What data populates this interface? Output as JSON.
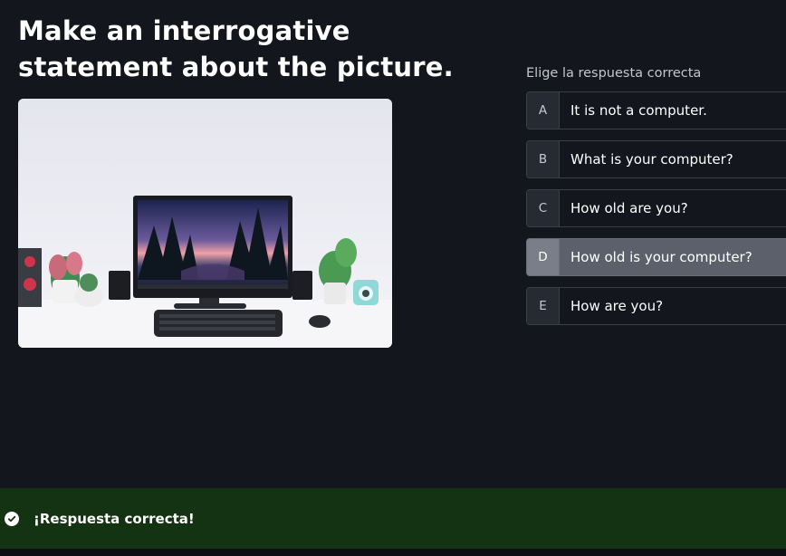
{
  "question": {
    "title": "Make an interrogative statement about the picture."
  },
  "image": {
    "subject": "desk-setup-photo"
  },
  "answers": {
    "prompt": "Elige la respuesta correcta",
    "selected": "D",
    "options": [
      {
        "letter": "A",
        "text": "It is not a computer."
      },
      {
        "letter": "B",
        "text": "What is your computer?"
      },
      {
        "letter": "C",
        "text": "How old are you?"
      },
      {
        "letter": "D",
        "text": "How old is your computer?"
      },
      {
        "letter": "E",
        "text": "How are you?"
      }
    ]
  },
  "feedback": {
    "icon": "check-circle-icon",
    "message": "¡Respuesta correcta!",
    "color": "#143312"
  },
  "colors": {
    "background": "#13161d",
    "selected_option": "#5c606b"
  }
}
